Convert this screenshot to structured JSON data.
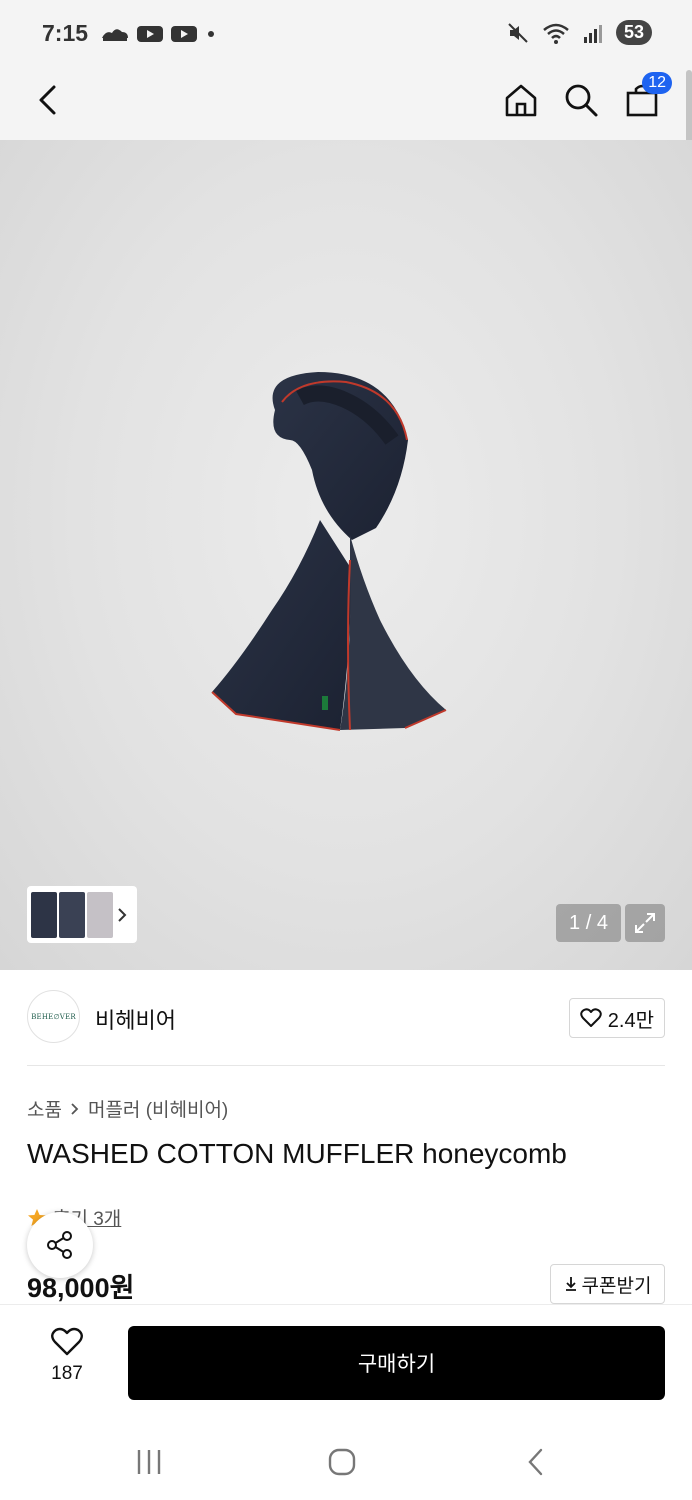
{
  "status_bar": {
    "time": "7:15",
    "battery": "53",
    "left_icons": [
      "cloud-icon",
      "youtube-icon",
      "youtube-icon",
      "dot-icon"
    ],
    "right_icons": [
      "mute-icon",
      "wifi-icon",
      "signal-icon"
    ]
  },
  "header": {
    "cart_count": "12",
    "icons": [
      "back-icon",
      "home-icon",
      "search-icon",
      "cart-icon"
    ]
  },
  "gallery": {
    "counter": "1 / 4"
  },
  "brand": {
    "logo_text": "BEHE∅VER",
    "name": "비헤비어",
    "likes": "2.4만"
  },
  "breadcrumb": {
    "category": "소품",
    "subcategory": "머플러 (비헤비어)"
  },
  "product": {
    "title": "WASHED COTTON MUFFLER honeycomb",
    "reviews": "후기 3개",
    "price": "98,000원",
    "coupon_label": "쿠폰받기"
  },
  "purchase": {
    "heart_count": "187",
    "buy_label": "구매하기"
  },
  "colors": {
    "accent": "#1e63f0",
    "star": "#f5a623",
    "buy_bg": "#000000"
  }
}
